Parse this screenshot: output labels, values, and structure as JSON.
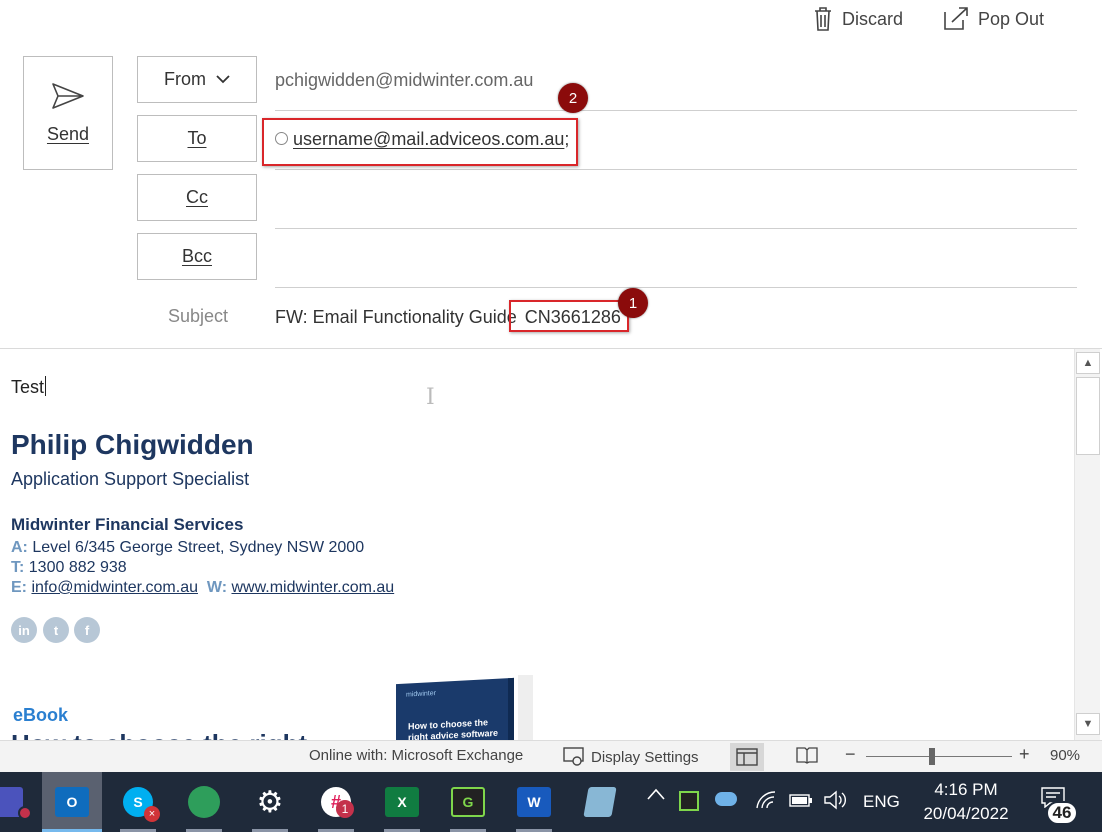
{
  "toolbar": {
    "discard_label": "Discard",
    "popout_label": "Pop Out"
  },
  "compose": {
    "send_label": "Send",
    "from_label": "From",
    "from_value": "pchigwidden@midwinter.com.au",
    "to_label": "To",
    "to_value": "username@mail.adviceos.com.au",
    "to_separator": ";",
    "cc_label": "Cc",
    "bcc_label": "Bcc",
    "subject_label": "Subject",
    "subject_prefix": "FW: Email Functionality Guide",
    "subject_code": "CN3661286",
    "annotation_1": "1",
    "annotation_2": "2"
  },
  "body": {
    "text": "Test",
    "signature": {
      "name": "Philip Chigwidden",
      "title": "Application Support Specialist",
      "company": "Midwinter Financial Services",
      "address_key": "A:",
      "address": "Level 6/345 George Street, Sydney NSW 2000",
      "phone_key": "T:",
      "phone": "1300 882 938",
      "email_key": "E:",
      "email": "info@midwinter.com.au",
      "web_key": "W:",
      "web": "www.midwinter.com.au",
      "social": [
        "in",
        "t",
        "f"
      ]
    },
    "ebook_label": "eBook",
    "ebook_title": "How to choose the right",
    "book_brand": "midwinter",
    "book_title": "How to choose the right advice software"
  },
  "statusbar": {
    "connection": "Online with: Microsoft Exchange",
    "display_settings": "Display Settings",
    "zoom_minus": "−",
    "zoom_plus": "+",
    "zoom_percent": "90%",
    "zoom_level": 0.9
  },
  "taskbar": {
    "apps": [
      {
        "name": "Teams",
        "color": "#4b53bc"
      },
      {
        "name": "Outlook",
        "color": "#0f6cbd",
        "letter": "O"
      },
      {
        "name": "Skype",
        "color": "#00aff0",
        "letter": "S"
      },
      {
        "name": "Globe",
        "color": "#2e9e5b"
      },
      {
        "name": "Settings",
        "color": "#ffffff"
      },
      {
        "name": "Slack",
        "color": "#e01e5a",
        "badge": "1"
      },
      {
        "name": "Excel",
        "color": "#107c41",
        "letter": "X"
      },
      {
        "name": "Greenshot",
        "color": "#3a8a2a",
        "letter": "G"
      },
      {
        "name": "Word",
        "color": "#185abd",
        "letter": "W"
      },
      {
        "name": "Notepad",
        "color": "#88b7d5"
      }
    ],
    "language": "ENG",
    "time": "4:16 PM",
    "date": "20/04/2022",
    "notifications": "46",
    "chevron": "^"
  }
}
